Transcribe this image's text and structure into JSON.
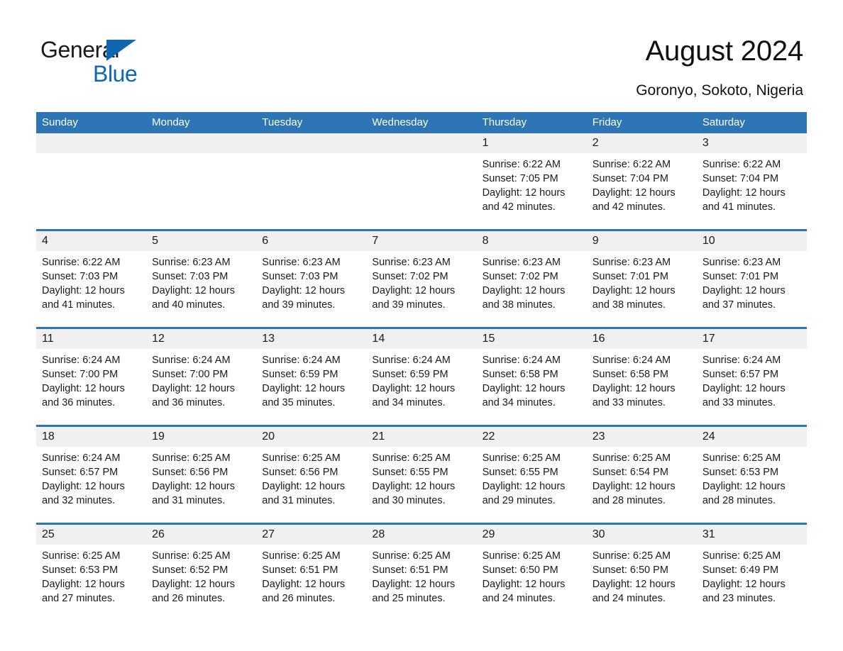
{
  "brand": {
    "name_top": "General",
    "name_bottom": "Blue",
    "triangle_color": "#1066b0"
  },
  "header": {
    "title": "August 2024",
    "location": "Goronyo, Sokoto, Nigeria"
  },
  "theme": {
    "header_blue": "#2e75b6",
    "daynum_band": "#f0f0f0",
    "text": "#1a1a1a",
    "page_background": "#ffffff"
  },
  "weekday_headers": [
    "Sunday",
    "Monday",
    "Tuesday",
    "Wednesday",
    "Thursday",
    "Friday",
    "Saturday"
  ],
  "weeks": [
    [
      {
        "day": "",
        "empty": true,
        "sunrise": "",
        "sunset": "",
        "daylight_line1": "",
        "daylight_line2": ""
      },
      {
        "day": "",
        "empty": true,
        "sunrise": "",
        "sunset": "",
        "daylight_line1": "",
        "daylight_line2": ""
      },
      {
        "day": "",
        "empty": true,
        "sunrise": "",
        "sunset": "",
        "daylight_line1": "",
        "daylight_line2": ""
      },
      {
        "day": "",
        "empty": true,
        "sunrise": "",
        "sunset": "",
        "daylight_line1": "",
        "daylight_line2": ""
      },
      {
        "day": "1",
        "empty": false,
        "sunrise": "Sunrise: 6:22 AM",
        "sunset": "Sunset: 7:05 PM",
        "daylight_line1": "Daylight: 12 hours",
        "daylight_line2": "and 42 minutes."
      },
      {
        "day": "2",
        "empty": false,
        "sunrise": "Sunrise: 6:22 AM",
        "sunset": "Sunset: 7:04 PM",
        "daylight_line1": "Daylight: 12 hours",
        "daylight_line2": "and 42 minutes."
      },
      {
        "day": "3",
        "empty": false,
        "sunrise": "Sunrise: 6:22 AM",
        "sunset": "Sunset: 7:04 PM",
        "daylight_line1": "Daylight: 12 hours",
        "daylight_line2": "and 41 minutes."
      }
    ],
    [
      {
        "day": "4",
        "empty": false,
        "sunrise": "Sunrise: 6:22 AM",
        "sunset": "Sunset: 7:03 PM",
        "daylight_line1": "Daylight: 12 hours",
        "daylight_line2": "and 41 minutes."
      },
      {
        "day": "5",
        "empty": false,
        "sunrise": "Sunrise: 6:23 AM",
        "sunset": "Sunset: 7:03 PM",
        "daylight_line1": "Daylight: 12 hours",
        "daylight_line2": "and 40 minutes."
      },
      {
        "day": "6",
        "empty": false,
        "sunrise": "Sunrise: 6:23 AM",
        "sunset": "Sunset: 7:03 PM",
        "daylight_line1": "Daylight: 12 hours",
        "daylight_line2": "and 39 minutes."
      },
      {
        "day": "7",
        "empty": false,
        "sunrise": "Sunrise: 6:23 AM",
        "sunset": "Sunset: 7:02 PM",
        "daylight_line1": "Daylight: 12 hours",
        "daylight_line2": "and 39 minutes."
      },
      {
        "day": "8",
        "empty": false,
        "sunrise": "Sunrise: 6:23 AM",
        "sunset": "Sunset: 7:02 PM",
        "daylight_line1": "Daylight: 12 hours",
        "daylight_line2": "and 38 minutes."
      },
      {
        "day": "9",
        "empty": false,
        "sunrise": "Sunrise: 6:23 AM",
        "sunset": "Sunset: 7:01 PM",
        "daylight_line1": "Daylight: 12 hours",
        "daylight_line2": "and 38 minutes."
      },
      {
        "day": "10",
        "empty": false,
        "sunrise": "Sunrise: 6:23 AM",
        "sunset": "Sunset: 7:01 PM",
        "daylight_line1": "Daylight: 12 hours",
        "daylight_line2": "and 37 minutes."
      }
    ],
    [
      {
        "day": "11",
        "empty": false,
        "sunrise": "Sunrise: 6:24 AM",
        "sunset": "Sunset: 7:00 PM",
        "daylight_line1": "Daylight: 12 hours",
        "daylight_line2": "and 36 minutes."
      },
      {
        "day": "12",
        "empty": false,
        "sunrise": "Sunrise: 6:24 AM",
        "sunset": "Sunset: 7:00 PM",
        "daylight_line1": "Daylight: 12 hours",
        "daylight_line2": "and 36 minutes."
      },
      {
        "day": "13",
        "empty": false,
        "sunrise": "Sunrise: 6:24 AM",
        "sunset": "Sunset: 6:59 PM",
        "daylight_line1": "Daylight: 12 hours",
        "daylight_line2": "and 35 minutes."
      },
      {
        "day": "14",
        "empty": false,
        "sunrise": "Sunrise: 6:24 AM",
        "sunset": "Sunset: 6:59 PM",
        "daylight_line1": "Daylight: 12 hours",
        "daylight_line2": "and 34 minutes."
      },
      {
        "day": "15",
        "empty": false,
        "sunrise": "Sunrise: 6:24 AM",
        "sunset": "Sunset: 6:58 PM",
        "daylight_line1": "Daylight: 12 hours",
        "daylight_line2": "and 34 minutes."
      },
      {
        "day": "16",
        "empty": false,
        "sunrise": "Sunrise: 6:24 AM",
        "sunset": "Sunset: 6:58 PM",
        "daylight_line1": "Daylight: 12 hours",
        "daylight_line2": "and 33 minutes."
      },
      {
        "day": "17",
        "empty": false,
        "sunrise": "Sunrise: 6:24 AM",
        "sunset": "Sunset: 6:57 PM",
        "daylight_line1": "Daylight: 12 hours",
        "daylight_line2": "and 33 minutes."
      }
    ],
    [
      {
        "day": "18",
        "empty": false,
        "sunrise": "Sunrise: 6:24 AM",
        "sunset": "Sunset: 6:57 PM",
        "daylight_line1": "Daylight: 12 hours",
        "daylight_line2": "and 32 minutes."
      },
      {
        "day": "19",
        "empty": false,
        "sunrise": "Sunrise: 6:25 AM",
        "sunset": "Sunset: 6:56 PM",
        "daylight_line1": "Daylight: 12 hours",
        "daylight_line2": "and 31 minutes."
      },
      {
        "day": "20",
        "empty": false,
        "sunrise": "Sunrise: 6:25 AM",
        "sunset": "Sunset: 6:56 PM",
        "daylight_line1": "Daylight: 12 hours",
        "daylight_line2": "and 31 minutes."
      },
      {
        "day": "21",
        "empty": false,
        "sunrise": "Sunrise: 6:25 AM",
        "sunset": "Sunset: 6:55 PM",
        "daylight_line1": "Daylight: 12 hours",
        "daylight_line2": "and 30 minutes."
      },
      {
        "day": "22",
        "empty": false,
        "sunrise": "Sunrise: 6:25 AM",
        "sunset": "Sunset: 6:55 PM",
        "daylight_line1": "Daylight: 12 hours",
        "daylight_line2": "and 29 minutes."
      },
      {
        "day": "23",
        "empty": false,
        "sunrise": "Sunrise: 6:25 AM",
        "sunset": "Sunset: 6:54 PM",
        "daylight_line1": "Daylight: 12 hours",
        "daylight_line2": "and 28 minutes."
      },
      {
        "day": "24",
        "empty": false,
        "sunrise": "Sunrise: 6:25 AM",
        "sunset": "Sunset: 6:53 PM",
        "daylight_line1": "Daylight: 12 hours",
        "daylight_line2": "and 28 minutes."
      }
    ],
    [
      {
        "day": "25",
        "empty": false,
        "sunrise": "Sunrise: 6:25 AM",
        "sunset": "Sunset: 6:53 PM",
        "daylight_line1": "Daylight: 12 hours",
        "daylight_line2": "and 27 minutes."
      },
      {
        "day": "26",
        "empty": false,
        "sunrise": "Sunrise: 6:25 AM",
        "sunset": "Sunset: 6:52 PM",
        "daylight_line1": "Daylight: 12 hours",
        "daylight_line2": "and 26 minutes."
      },
      {
        "day": "27",
        "empty": false,
        "sunrise": "Sunrise: 6:25 AM",
        "sunset": "Sunset: 6:51 PM",
        "daylight_line1": "Daylight: 12 hours",
        "daylight_line2": "and 26 minutes."
      },
      {
        "day": "28",
        "empty": false,
        "sunrise": "Sunrise: 6:25 AM",
        "sunset": "Sunset: 6:51 PM",
        "daylight_line1": "Daylight: 12 hours",
        "daylight_line2": "and 25 minutes."
      },
      {
        "day": "29",
        "empty": false,
        "sunrise": "Sunrise: 6:25 AM",
        "sunset": "Sunset: 6:50 PM",
        "daylight_line1": "Daylight: 12 hours",
        "daylight_line2": "and 24 minutes."
      },
      {
        "day": "30",
        "empty": false,
        "sunrise": "Sunrise: 6:25 AM",
        "sunset": "Sunset: 6:50 PM",
        "daylight_line1": "Daylight: 12 hours",
        "daylight_line2": "and 24 minutes."
      },
      {
        "day": "31",
        "empty": false,
        "sunrise": "Sunrise: 6:25 AM",
        "sunset": "Sunset: 6:49 PM",
        "daylight_line1": "Daylight: 12 hours",
        "daylight_line2": "and 23 minutes."
      }
    ]
  ]
}
